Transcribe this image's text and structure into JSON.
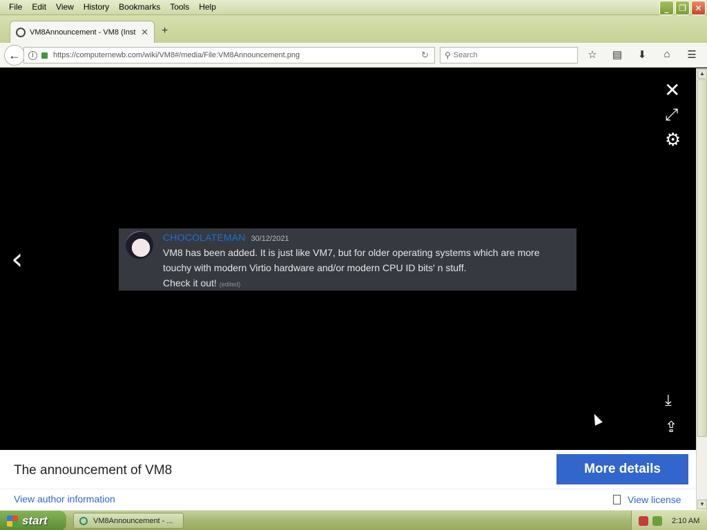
{
  "menu": [
    {
      "label": "File",
      "key": "F"
    },
    {
      "label": "Edit",
      "key": "E"
    },
    {
      "label": "View",
      "key": "V"
    },
    {
      "label": "History",
      "key": "s"
    },
    {
      "label": "Bookmarks",
      "key": "B"
    },
    {
      "label": "Tools",
      "key": "T"
    },
    {
      "label": "Help",
      "key": "H"
    }
  ],
  "window_buttons": {
    "minimize": "_",
    "restore": "❐",
    "close": "✕"
  },
  "tab": {
    "title": "VM8Announcement - VM8 (Inst",
    "close": "✕"
  },
  "newtab": "+",
  "address": {
    "url": "https://computernewb.com/wiki/VM8#/media/File:VM8Announcement.png"
  },
  "search": {
    "placeholder": "Search"
  },
  "nav_icons": [
    "star-icon",
    "reading-list-icon",
    "download-icon",
    "home-icon",
    "menu-icon"
  ],
  "viewer": {
    "controls": {
      "close": "✕",
      "expand": "⤢",
      "settings": "⚙",
      "prev": "‹",
      "download": "⤓",
      "share": "⇪"
    }
  },
  "message": {
    "username": "CHOCOLATEMAN",
    "date": "30/12/2021",
    "line1": "VM8 has been added. It is just like VM7, but for older operating systems which are more",
    "line2": "touchy with modern Virtio hardware and/or modern CPU ID bits' n stuff.",
    "line3": "Check it out!",
    "edited": "(edited)"
  },
  "info": {
    "caption": "The announcement of VM8",
    "more_details": "More details",
    "author_link": "View author information",
    "license_link": "View license"
  },
  "taskbar": {
    "start": "start",
    "task_item": "VM8Announcement - ...",
    "clock": "2:10 AM"
  },
  "colors": {
    "link": "#3366cc",
    "discord_bg": "#36393f",
    "username": "#1e6fd6"
  }
}
